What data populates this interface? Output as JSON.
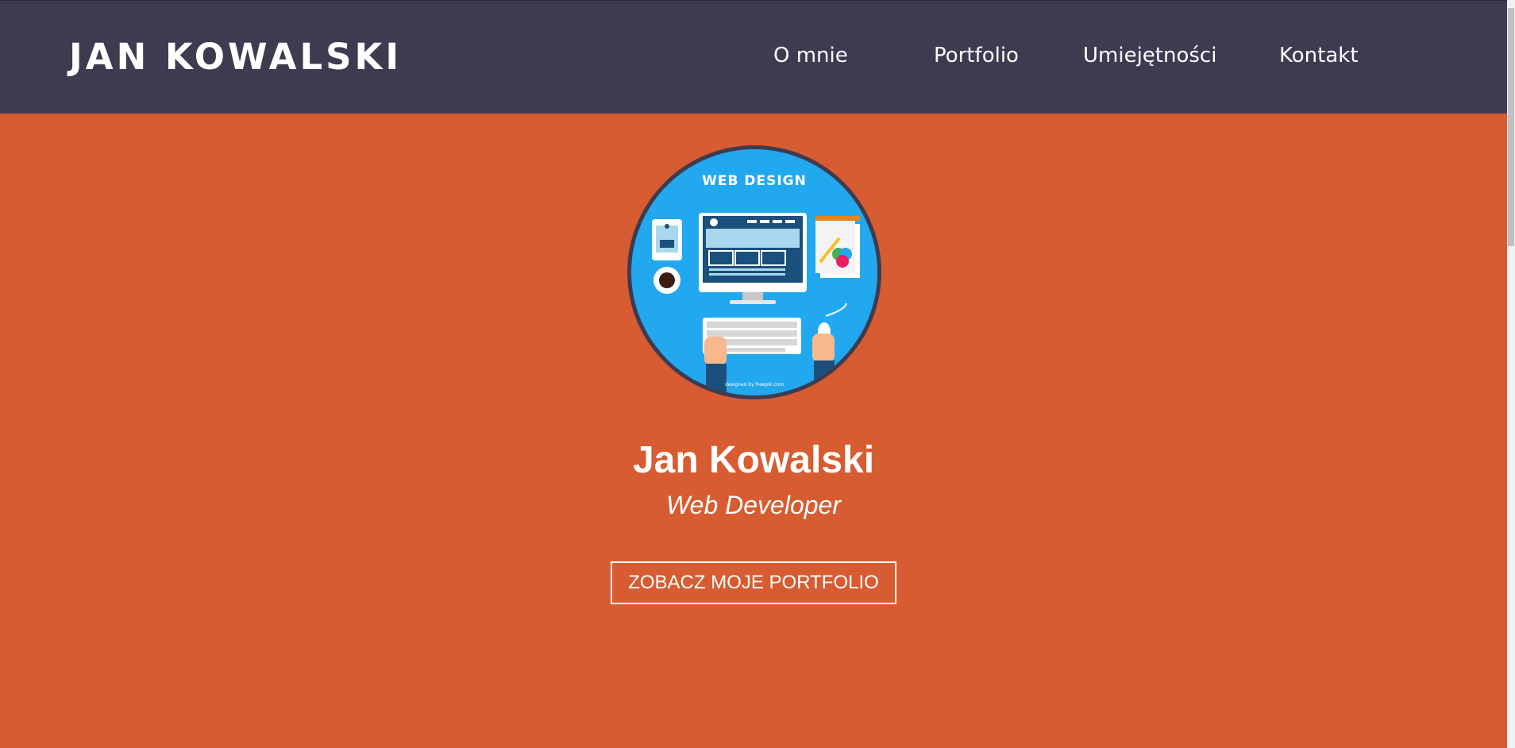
{
  "nav": {
    "brand": "JAN KOWALSKI",
    "links": [
      "O mnie",
      "Portfolio",
      "Umiejętności",
      "Kontakt"
    ]
  },
  "hero": {
    "avatar_caption": "WEB DESIGN",
    "avatar_credit": "designed by freepik.com",
    "name": "Jan Kowalski",
    "role": "Web Developer",
    "cta_label": "ZOBACZ MOJE PORTFOLIO"
  },
  "colors": {
    "navbar": "#3e3b50",
    "hero_background": "#d75c31",
    "avatar_background": "#22a8ef",
    "text": "#ffffff"
  }
}
